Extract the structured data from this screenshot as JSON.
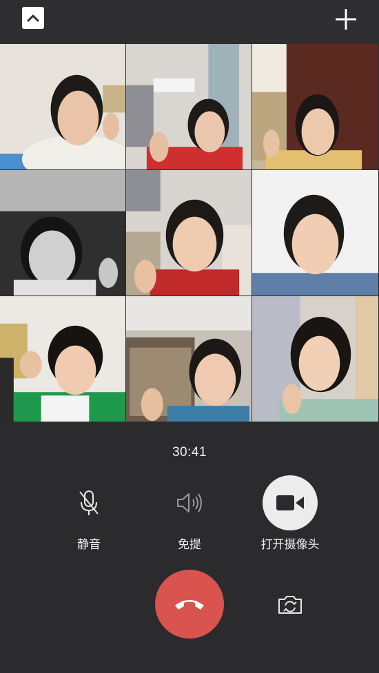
{
  "header": {
    "collapse_icon": "chevron-up-icon",
    "add_icon": "plus-icon"
  },
  "participants": [
    {
      "label": "participant 1"
    },
    {
      "label": "participant 2"
    },
    {
      "label": "participant 3"
    },
    {
      "label": "participant 4"
    },
    {
      "label": "participant 5"
    },
    {
      "label": "participant 6"
    },
    {
      "label": "participant 7"
    },
    {
      "label": "participant 8"
    },
    {
      "label": "participant 9"
    }
  ],
  "call": {
    "duration": "30:41"
  },
  "controls": {
    "mute_label": "静音",
    "speaker_label": "免提",
    "camera_label": "打开摄像头"
  },
  "colors": {
    "background": "#2b2b2d",
    "hangup": "#d9534f",
    "camera_button": "#ececec"
  }
}
